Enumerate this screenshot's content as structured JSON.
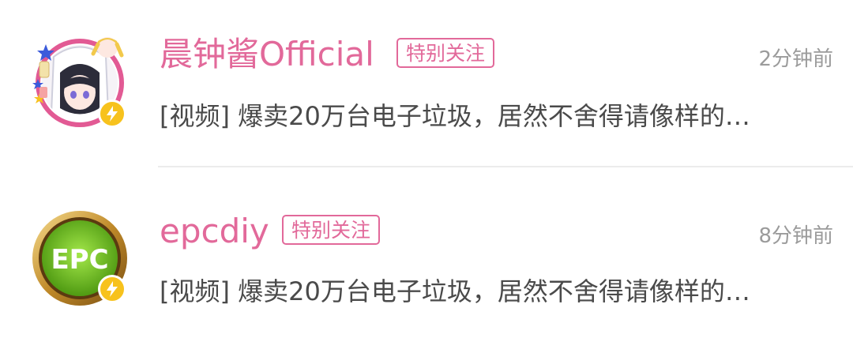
{
  "messages": [
    {
      "name": "晨钟酱Official",
      "badge": "特别关注",
      "time": "2分钟前",
      "preview": "[视频] 爆卖20万台电子垃圾，居然不舍得请像样的…",
      "avatar_icon": "anime-avatar-icon",
      "verified_icon": "lightning-badge-icon"
    },
    {
      "name": "epcdiy",
      "badge": "特别关注",
      "time": "8分钟前",
      "preview": "[视频] 爆卖20万台电子垃圾，居然不舍得请像样的…",
      "avatar_icon": "epc-logo-avatar-icon",
      "verified_icon": "lightning-badge-icon"
    }
  ],
  "colors": {
    "accent": "#e2699a",
    "time": "#9b9b9b",
    "text": "#4a4a4a",
    "verified": "#f7c21d",
    "divider": "#ececec"
  }
}
